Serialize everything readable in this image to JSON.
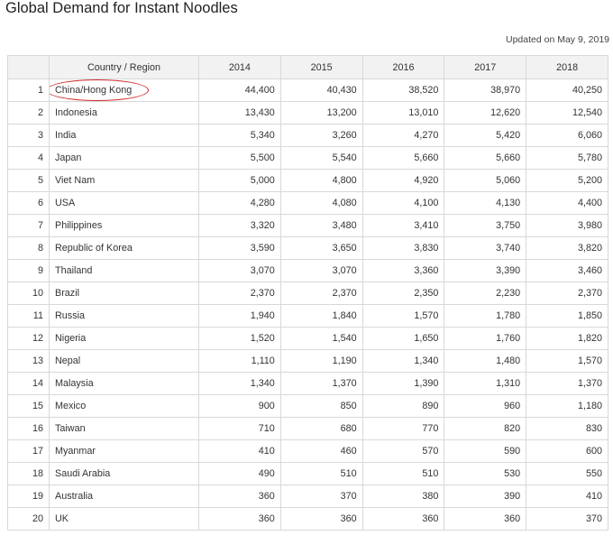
{
  "title": "Global Demand for Instant Noodles",
  "updated": "Updated on May 9, 2019",
  "highlight_color": "#d02a2a",
  "chart_data": {
    "type": "table",
    "title": "Global Demand for Instant Noodles",
    "columns": [
      "",
      "Country / Region",
      "2014",
      "2015",
      "2016",
      "2017",
      "2018"
    ],
    "rows": [
      {
        "rank": "1",
        "country": "China/Hong Kong",
        "values": [
          "44,400",
          "40,430",
          "38,520",
          "38,970",
          "40,250"
        ],
        "highlighted": true
      },
      {
        "rank": "2",
        "country": "Indonesia",
        "values": [
          "13,430",
          "13,200",
          "13,010",
          "12,620",
          "12,540"
        ]
      },
      {
        "rank": "3",
        "country": "India",
        "values": [
          "5,340",
          "3,260",
          "4,270",
          "5,420",
          "6,060"
        ]
      },
      {
        "rank": "4",
        "country": "Japan",
        "values": [
          "5,500",
          "5,540",
          "5,660",
          "5,660",
          "5,780"
        ]
      },
      {
        "rank": "5",
        "country": "Viet Nam",
        "values": [
          "5,000",
          "4,800",
          "4,920",
          "5,060",
          "5,200"
        ]
      },
      {
        "rank": "6",
        "country": "USA",
        "values": [
          "4,280",
          "4,080",
          "4,100",
          "4,130",
          "4,400"
        ]
      },
      {
        "rank": "7",
        "country": "Philippines",
        "values": [
          "3,320",
          "3,480",
          "3,410",
          "3,750",
          "3,980"
        ]
      },
      {
        "rank": "8",
        "country": "Republic of Korea",
        "values": [
          "3,590",
          "3,650",
          "3,830",
          "3,740",
          "3,820"
        ]
      },
      {
        "rank": "9",
        "country": "Thailand",
        "values": [
          "3,070",
          "3,070",
          "3,360",
          "3,390",
          "3,460"
        ]
      },
      {
        "rank": "10",
        "country": "Brazil",
        "values": [
          "2,370",
          "2,370",
          "2,350",
          "2,230",
          "2,370"
        ]
      },
      {
        "rank": "11",
        "country": "Russia",
        "values": [
          "1,940",
          "1,840",
          "1,570",
          "1,780",
          "1,850"
        ]
      },
      {
        "rank": "12",
        "country": "Nigeria",
        "values": [
          "1,520",
          "1,540",
          "1,650",
          "1,760",
          "1,820"
        ]
      },
      {
        "rank": "13",
        "country": "Nepal",
        "values": [
          "1,110",
          "1,190",
          "1,340",
          "1,480",
          "1,570"
        ]
      },
      {
        "rank": "14",
        "country": "Malaysia",
        "values": [
          "1,340",
          "1,370",
          "1,390",
          "1,310",
          "1,370"
        ]
      },
      {
        "rank": "15",
        "country": "Mexico",
        "values": [
          "900",
          "850",
          "890",
          "960",
          "1,180"
        ]
      },
      {
        "rank": "16",
        "country": "Taiwan",
        "values": [
          "710",
          "680",
          "770",
          "820",
          "830"
        ]
      },
      {
        "rank": "17",
        "country": "Myanmar",
        "values": [
          "410",
          "460",
          "570",
          "590",
          "600"
        ]
      },
      {
        "rank": "18",
        "country": "Saudi Arabia",
        "values": [
          "490",
          "510",
          "510",
          "530",
          "550"
        ]
      },
      {
        "rank": "19",
        "country": "Australia",
        "values": [
          "360",
          "370",
          "380",
          "390",
          "410"
        ]
      },
      {
        "rank": "20",
        "country": "UK",
        "values": [
          "360",
          "360",
          "360",
          "360",
          "370"
        ]
      }
    ]
  }
}
